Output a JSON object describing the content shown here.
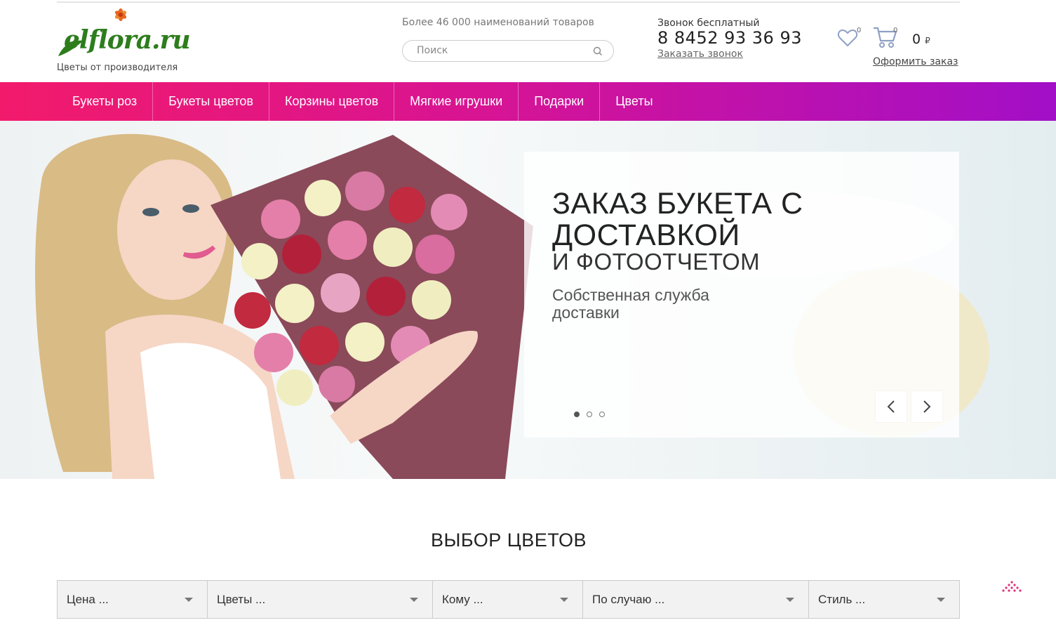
{
  "header": {
    "logo_text": "elflora.ru",
    "tagline": "Цветы от производителя",
    "items_count": "Более 46 000 наименований товаров",
    "search_placeholder": "Поиск",
    "call_label": "Звонок бесплатный",
    "phone": "8 8452 93 36 93",
    "order_call": "Заказать звонок",
    "favorites_count": "0",
    "cart_count": "0",
    "cart_total": "0",
    "currency": "₽",
    "checkout": "Оформить заказ"
  },
  "nav": {
    "items": [
      {
        "label": "Букеты роз"
      },
      {
        "label": "Букеты цветов"
      },
      {
        "label": "Корзины цветов"
      },
      {
        "label": "Мягкие игрушки"
      },
      {
        "label": "Подарки"
      },
      {
        "label": "Цветы"
      }
    ]
  },
  "hero": {
    "title_line1": "ЗАКАЗ БУКЕТА С",
    "title_line2": "ДОСТАВКОЙ",
    "subtitle": "И ФОТООТЧЕТОМ",
    "text": "Собственная служба доставки",
    "slide_count": 3,
    "active_slide": 1
  },
  "section": {
    "title": "ВЫБОР ЦВЕТОВ"
  },
  "filters": [
    {
      "label": "Цена ..."
    },
    {
      "label": "Цветы ..."
    },
    {
      "label": "Кому ..."
    },
    {
      "label": "По случаю ..."
    },
    {
      "label": "Стиль ..."
    }
  ],
  "colors": {
    "nav_start": "#f21a6b",
    "nav_end": "#a20fc7",
    "logo_green": "#2d7d1c"
  }
}
